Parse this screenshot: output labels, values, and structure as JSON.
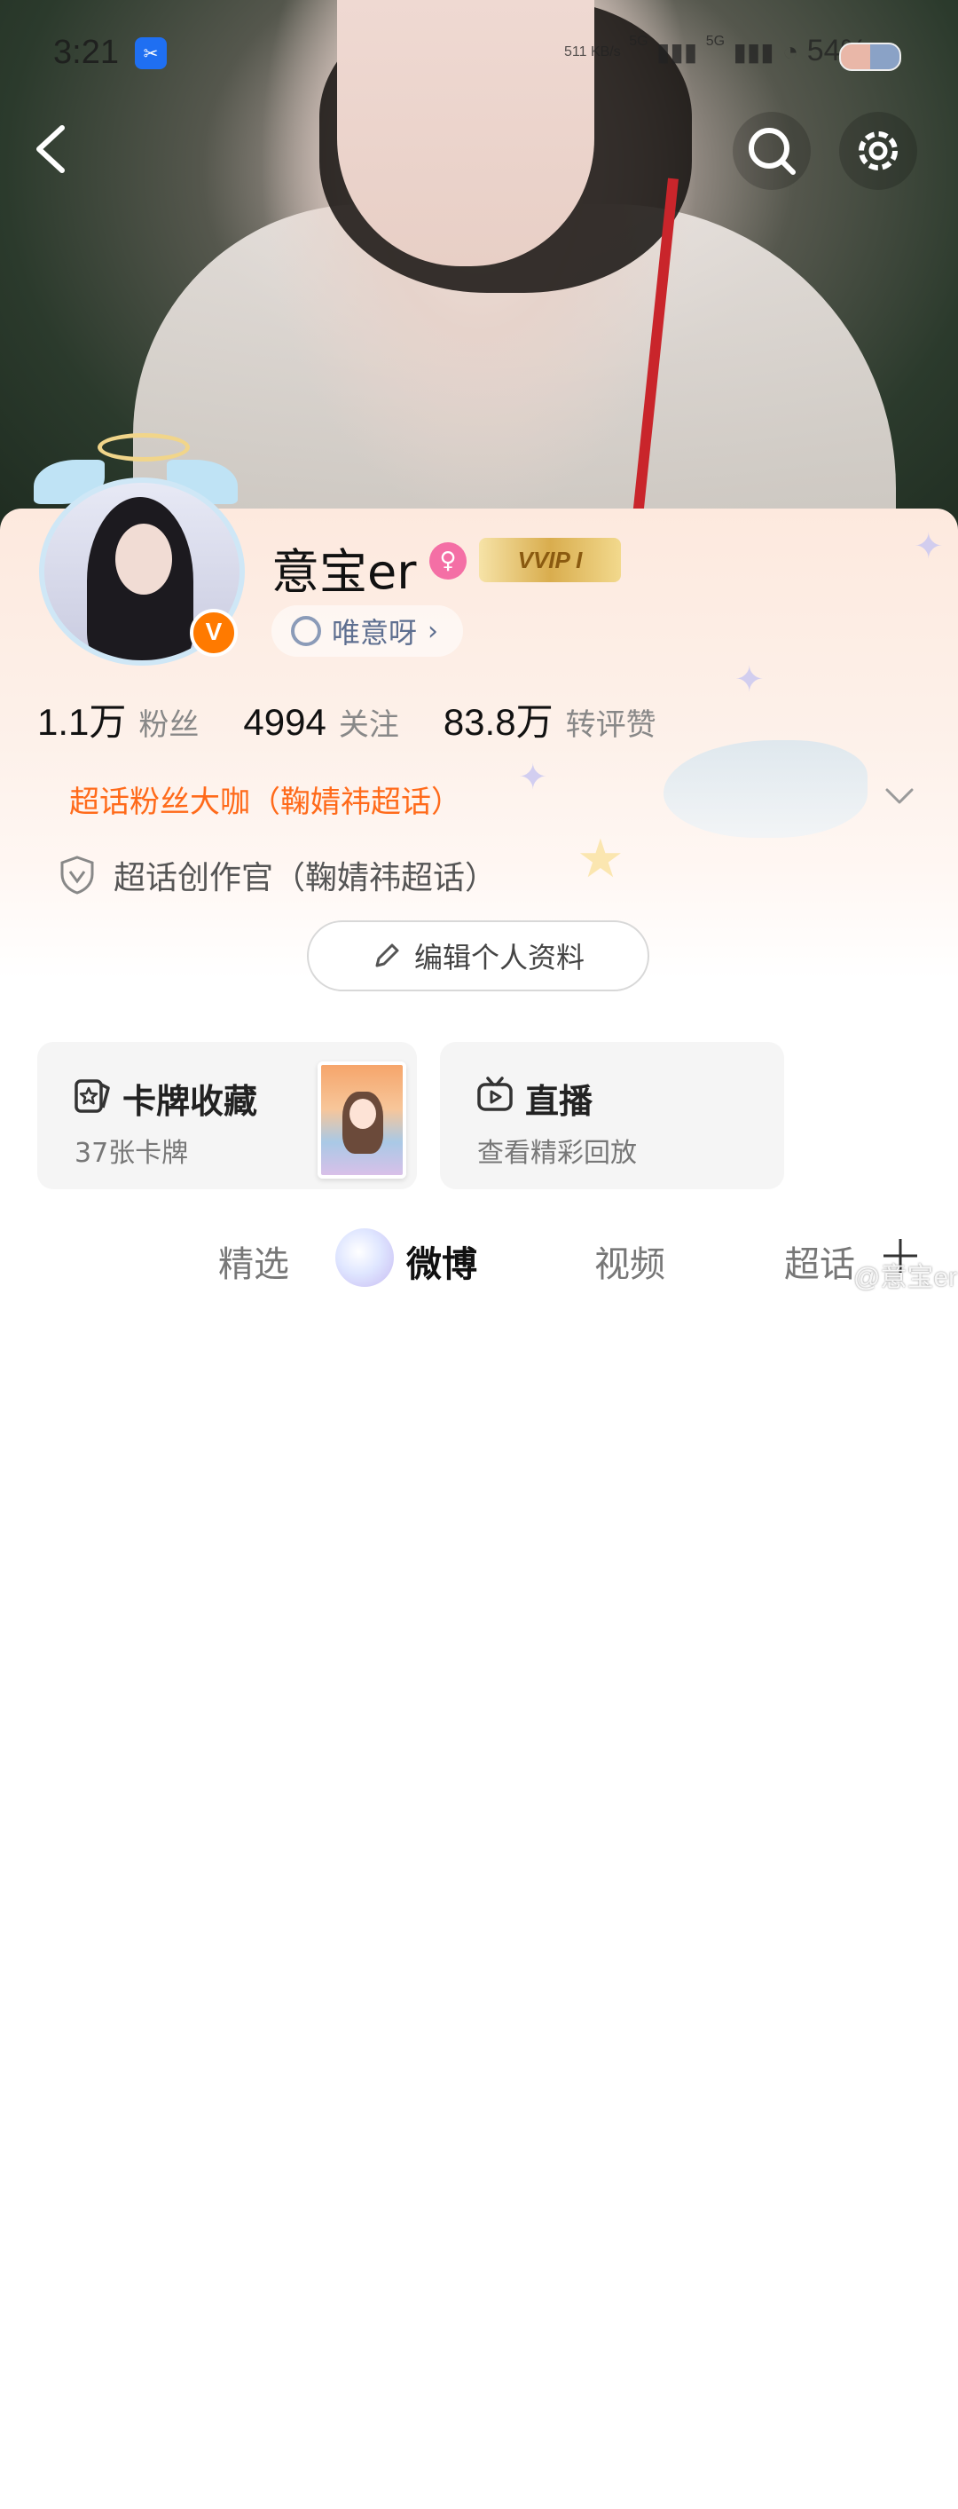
{
  "status_bar": {
    "time": "3:21",
    "network_speed": "511 KB/s",
    "signal1": "5G",
    "signal2": "5G",
    "battery": "54%"
  },
  "header": {
    "back_icon": "chevron-left-icon",
    "search_icon": "search-icon",
    "settings_icon": "gear-icon"
  },
  "profile": {
    "username": "意宝er",
    "gender_icon": "female-icon",
    "vip_badge": "VVIP I",
    "verified_badge": "V",
    "fan_club": "唯意呀",
    "stats": [
      {
        "value": "1.1万",
        "label": "粉丝"
      },
      {
        "value": "4994",
        "label": "关注"
      },
      {
        "value": "83.8万",
        "label": "转评赞"
      }
    ],
    "super_topic_badge": "超话粉丝大咖（鞠婧祎超话）",
    "creator_title": "超话创作官（鞠婧祎超话）",
    "edit_button": "编辑个人资料"
  },
  "cards": {
    "collection": {
      "title": "卡牌收藏",
      "subtitle": "37张卡牌"
    },
    "live": {
      "title": "直播",
      "subtitle": "查看精彩回放"
    }
  },
  "tabs": [
    {
      "label": "精选"
    },
    {
      "label": "微博"
    },
    {
      "label": "视频"
    },
    {
      "label": "超话"
    }
  ],
  "watermark": "@意宝er",
  "colors": {
    "accent_orange": "#ff6a1a",
    "verified_orange": "#ff7a00",
    "fan_club_text": "#5e6f90"
  }
}
